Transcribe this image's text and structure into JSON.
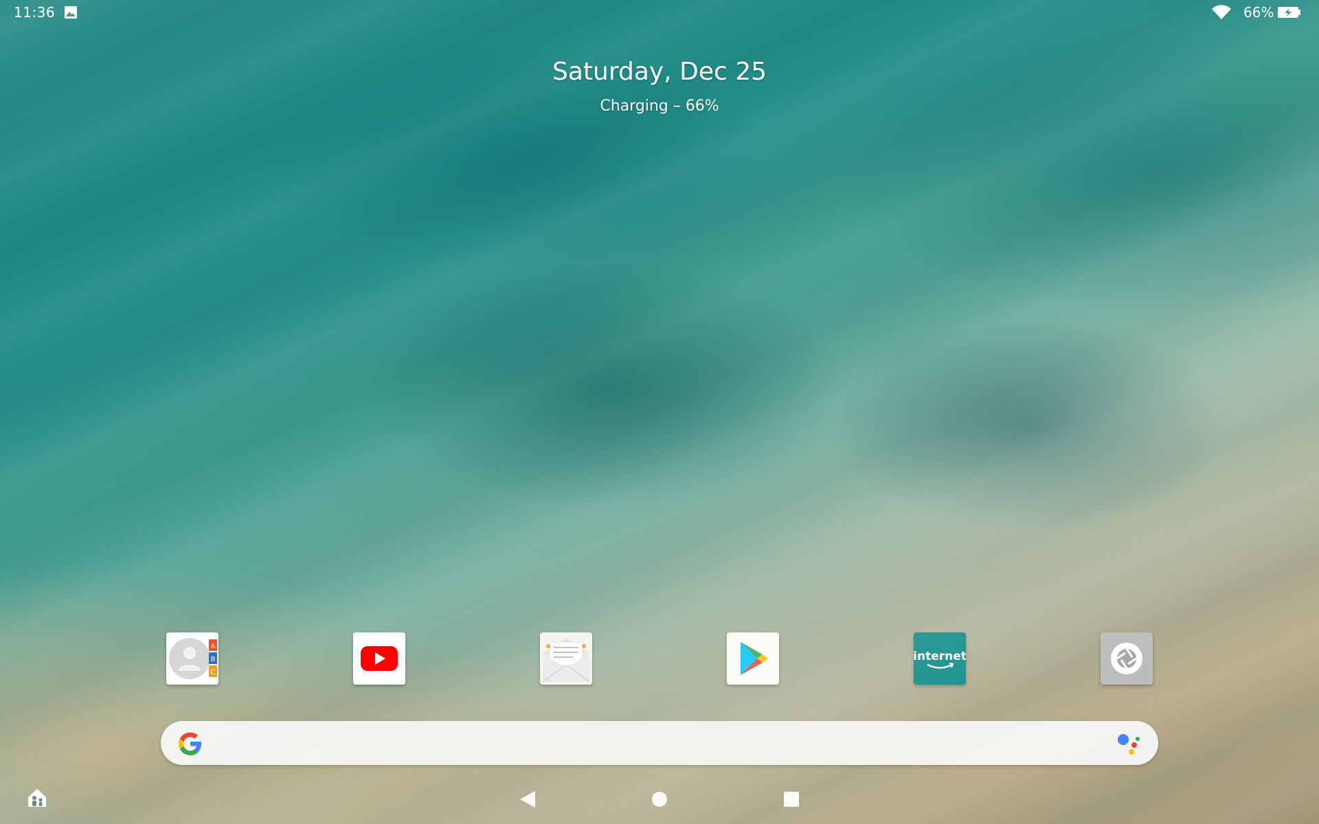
{
  "status_bar": {
    "time": "11:36",
    "battery_percent": "66%",
    "icons": [
      "gallery-icon",
      "wifi-icon",
      "battery-charging-icon"
    ]
  },
  "home": {
    "date": "Saturday, Dec 25",
    "charging": "Charging – 66%"
  },
  "dock": {
    "apps": [
      {
        "name": "contacts-app-icon",
        "icon_letters": [
          "A",
          "B",
          "C"
        ]
      },
      {
        "name": "youtube-app-icon"
      },
      {
        "name": "email-app-icon"
      },
      {
        "name": "play-store-app-icon"
      },
      {
        "name": "amazon-internet-app-icon",
        "label": "internet"
      },
      {
        "name": "camera-app-icon"
      }
    ]
  },
  "search": {
    "placeholder": "",
    "icons": [
      "google-g-icon",
      "google-assistant-icon"
    ]
  },
  "nav_bar": {
    "icons": [
      "kids-home-icon",
      "back-icon",
      "home-icon",
      "recents-icon"
    ]
  },
  "colors": {
    "youtube_red": "#ff0000",
    "amazon_teal": "#0e8c8c",
    "google_blue": "#4285f4",
    "google_red": "#ea4335",
    "google_yellow": "#fbbc05",
    "google_green": "#34a853"
  }
}
